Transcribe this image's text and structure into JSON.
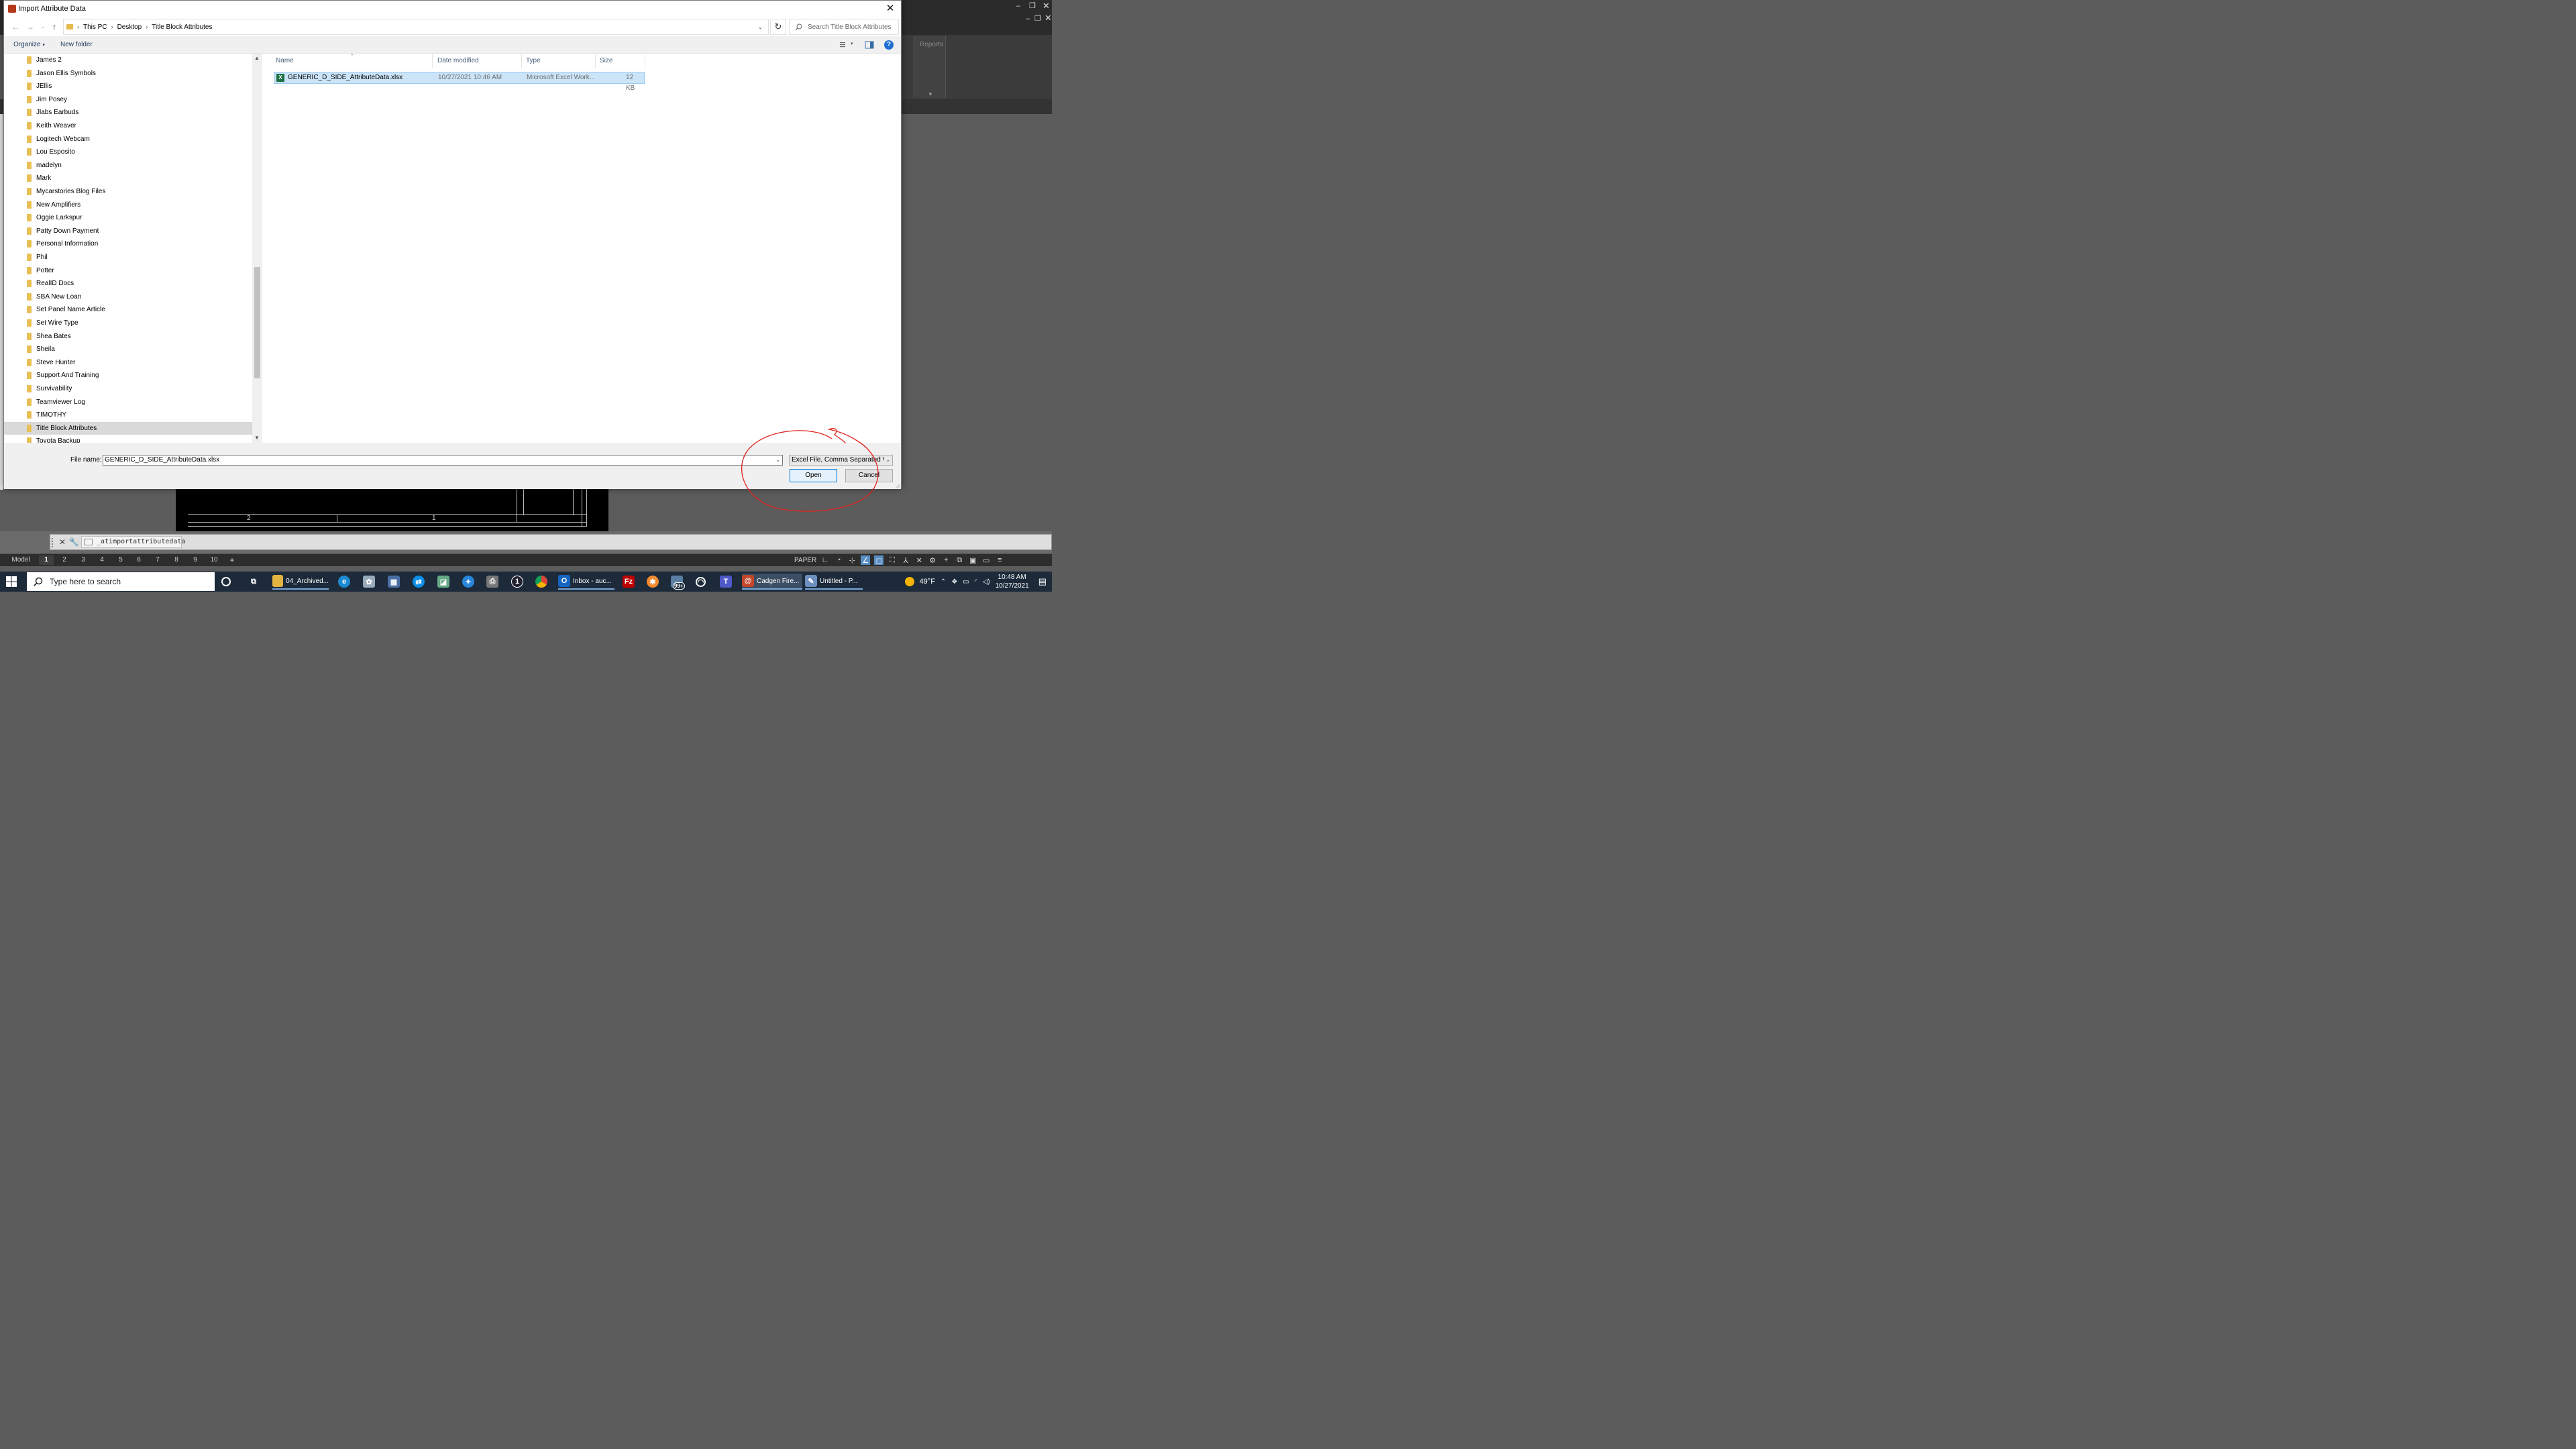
{
  "dialog": {
    "title": "Import Attribute Data",
    "breadcrumb": [
      "This PC",
      "Desktop",
      "Title Block Attributes"
    ],
    "search_placeholder": "Search Title Block Attributes",
    "toolbar": {
      "organize": "Organize",
      "new_folder": "New folder"
    },
    "nav_items": [
      "James 2",
      "Jason Ellis Symbols",
      "JEllis",
      "Jim Posey",
      "Jlabs Earbuds",
      "Keith Weaver",
      "Logitech Webcam",
      "Lou Esposito",
      "madelyn",
      "Mark",
      "Mycarstories Blog Files",
      "New Amplifiers",
      "Oggie Larkspur",
      "Patty Down Payment",
      "Personal Information",
      "Phil",
      "Potter",
      "RealID Docs",
      "SBA New Loan",
      "Set Panel Name Article",
      "Set Wire Type",
      "Shea Bates",
      "Sheila",
      "Steve Hunter",
      "Support And Training",
      "Survivability",
      "Teamviewer Log",
      "TIMOTHY",
      "Title Block Attributes",
      "Toyota Backup"
    ],
    "selected_nav": "Title Block Attributes",
    "columns": {
      "name": "Name",
      "date": "Date modified",
      "type": "Type",
      "size": "Size"
    },
    "files": [
      {
        "name": "GENERIC_D_SIDE_AttributeData.xlsx",
        "date": "10/27/2021 10:46 AM",
        "type": "Microsoft Excel Work...",
        "size": "12 KB"
      }
    ],
    "file_name_label": "File name:",
    "file_name_value": "GENERIC_D_SIDE_AttributeData.xlsx",
    "file_type": "Excel File, Comma Separated Va",
    "open_label": "Open",
    "cancel_label": "Cancel"
  },
  "cad": {
    "ribbon_panel_label": "Reports",
    "command_text": "_atimportattributedata",
    "layout_tabs": [
      "Model",
      "1",
      "2",
      "3",
      "4",
      "5",
      "6",
      "7",
      "8",
      "9",
      "10",
      "+"
    ],
    "active_layout_tab": "1",
    "paper_label": "PAPER",
    "drawing_numbers": [
      "2",
      "1"
    ]
  },
  "taskbar": {
    "search_placeholder": "Type here to search",
    "apps": [
      {
        "label": "04_Archived...",
        "icon": "file-explorer-icon",
        "color": "#e3b341"
      },
      {
        "label": "Inbox - auc...",
        "icon": "outlook-icon",
        "color": "#1565c0"
      },
      {
        "label": "Cadgen Fire...",
        "icon": "cadgen-icon",
        "color": "#c2452a"
      },
      {
        "label": "Untitled - P...",
        "icon": "paint-icon",
        "color": "#6c8fbf"
      }
    ],
    "notification_badge": "99+",
    "weather": "49°F",
    "time": "10:48 AM",
    "date": "10/27/2021"
  },
  "colors": {
    "selection": "#cce4f7",
    "accent": "#0078d7",
    "annotation": "#e0201c",
    "cad_dark": "#2d2d2d"
  }
}
